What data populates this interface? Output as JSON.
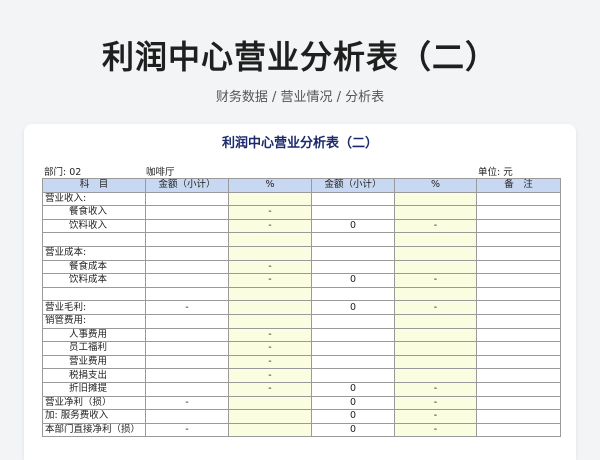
{
  "page": {
    "title": "利润中心营业分析表（二）",
    "subtitle": "财务数据 / 营业情况 / 分析表"
  },
  "sheet": {
    "title": "利润中心营业分析表（二）",
    "dept_label": "部门: 02",
    "dept_name": "咖啡厅",
    "unit_label": "单位: 元",
    "headers": [
      "科　目",
      "金额（小计）",
      "%",
      "金额（小计）",
      "%",
      "备　注"
    ],
    "rows": [
      {
        "item": "营业收入:",
        "indent": false,
        "amt1": "",
        "pct1": "",
        "amt2": "",
        "pct2": "",
        "note": ""
      },
      {
        "item": "餐食收入",
        "indent": true,
        "amt1": "",
        "pct1": "-",
        "amt2": "",
        "pct2": "",
        "note": ""
      },
      {
        "item": "饮料收入",
        "indent": true,
        "amt1": "",
        "pct1": "-",
        "amt2": "0",
        "pct2": "-",
        "note": ""
      },
      {
        "item": "",
        "indent": false,
        "amt1": "",
        "pct1": "",
        "amt2": "",
        "pct2": "",
        "note": ""
      },
      {
        "item": "营业成本:",
        "indent": false,
        "amt1": "",
        "pct1": "",
        "amt2": "",
        "pct2": "",
        "note": ""
      },
      {
        "item": "餐食成本",
        "indent": true,
        "amt1": "",
        "pct1": "-",
        "amt2": "",
        "pct2": "",
        "note": ""
      },
      {
        "item": "饮料成本",
        "indent": true,
        "amt1": "",
        "pct1": "-",
        "amt2": "0",
        "pct2": "-",
        "note": ""
      },
      {
        "item": "",
        "indent": false,
        "amt1": "",
        "pct1": "",
        "amt2": "",
        "pct2": "",
        "note": ""
      },
      {
        "item": "营业毛利:",
        "indent": false,
        "amt1": "-",
        "pct1": "",
        "amt2": "0",
        "pct2": "-",
        "note": ""
      },
      {
        "item": "销管费用:",
        "indent": false,
        "amt1": "",
        "pct1": "",
        "amt2": "",
        "pct2": "",
        "note": ""
      },
      {
        "item": "人事费用",
        "indent": true,
        "amt1": "",
        "pct1": "-",
        "amt2": "",
        "pct2": "",
        "note": ""
      },
      {
        "item": "员工福利",
        "indent": true,
        "amt1": "",
        "pct1": "-",
        "amt2": "",
        "pct2": "",
        "note": ""
      },
      {
        "item": "营业费用",
        "indent": true,
        "amt1": "",
        "pct1": "-",
        "amt2": "",
        "pct2": "",
        "note": ""
      },
      {
        "item": "税捐支出",
        "indent": true,
        "amt1": "",
        "pct1": "-",
        "amt2": "",
        "pct2": "",
        "note": ""
      },
      {
        "item": "折旧摊提",
        "indent": true,
        "amt1": "",
        "pct1": "-",
        "amt2": "0",
        "pct2": "-",
        "note": ""
      },
      {
        "item": "营业净利（损）",
        "indent": false,
        "amt1": "-",
        "pct1": "",
        "amt2": "0",
        "pct2": "-",
        "note": ""
      },
      {
        "item": "加: 服务费收入",
        "indent": false,
        "amt1": "",
        "pct1": "",
        "amt2": "0",
        "pct2": "-",
        "note": ""
      },
      {
        "item": "本部门直接净利（损）",
        "indent": false,
        "amt1": "-",
        "pct1": "",
        "amt2": "0",
        "pct2": "-",
        "note": ""
      }
    ]
  },
  "colors": {
    "header_fill": "#c9d8f2",
    "pct_fill": "#fbfde0",
    "sheet_title": "#1a2a6c"
  }
}
